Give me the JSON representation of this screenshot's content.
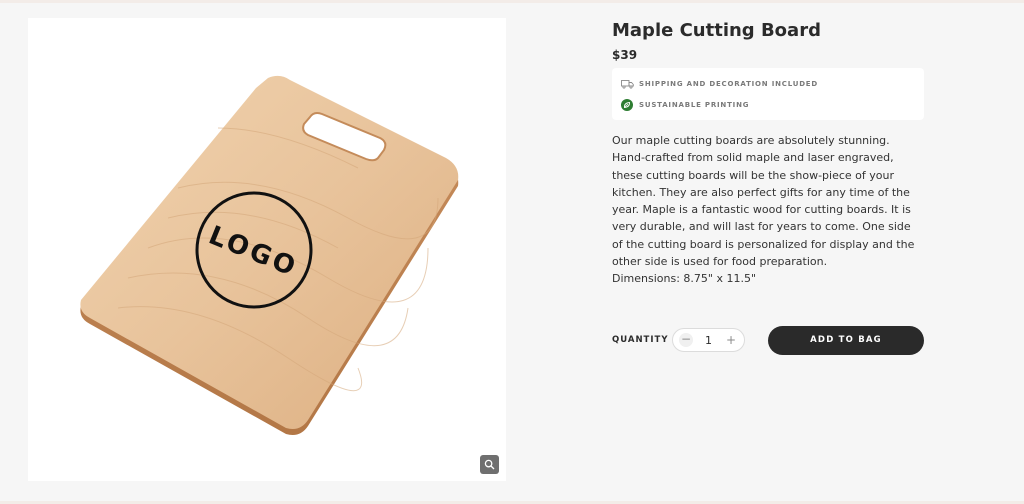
{
  "product": {
    "title": "Maple Cutting Board",
    "price": "$39",
    "image_logo_text": "LOGO",
    "zoom_icon": "magnifier-icon"
  },
  "features": [
    {
      "icon": "truck-icon",
      "text": "SHIPPING AND DECORATION INCLUDED"
    },
    {
      "icon": "leaf-icon",
      "text": "SUSTAINABLE PRINTING"
    }
  ],
  "description": {
    "paragraph": "Our maple cutting boards are absolutely stunning. Hand-crafted from solid maple and laser engraved, these cutting boards will be the show-piece of your kitchen. They are also perfect gifts for any time of the year.  Maple is a fantastic wood for cutting boards. It is very durable, and will last for years to come. One side of the cutting board is personalized for display and the other side is used for food preparation.",
    "dimensions": "Dimensions: 8.75\" x 11.5\""
  },
  "purchase": {
    "quantity_label": "QUANTITY",
    "quantity_value": "1",
    "minus": "−",
    "plus": "+",
    "add_to_bag_label": "ADD TO BAG"
  },
  "colors": {
    "accent_dark": "#2a2a2a",
    "leaf_green": "#2e7d32",
    "wood": "#e9c49c"
  }
}
